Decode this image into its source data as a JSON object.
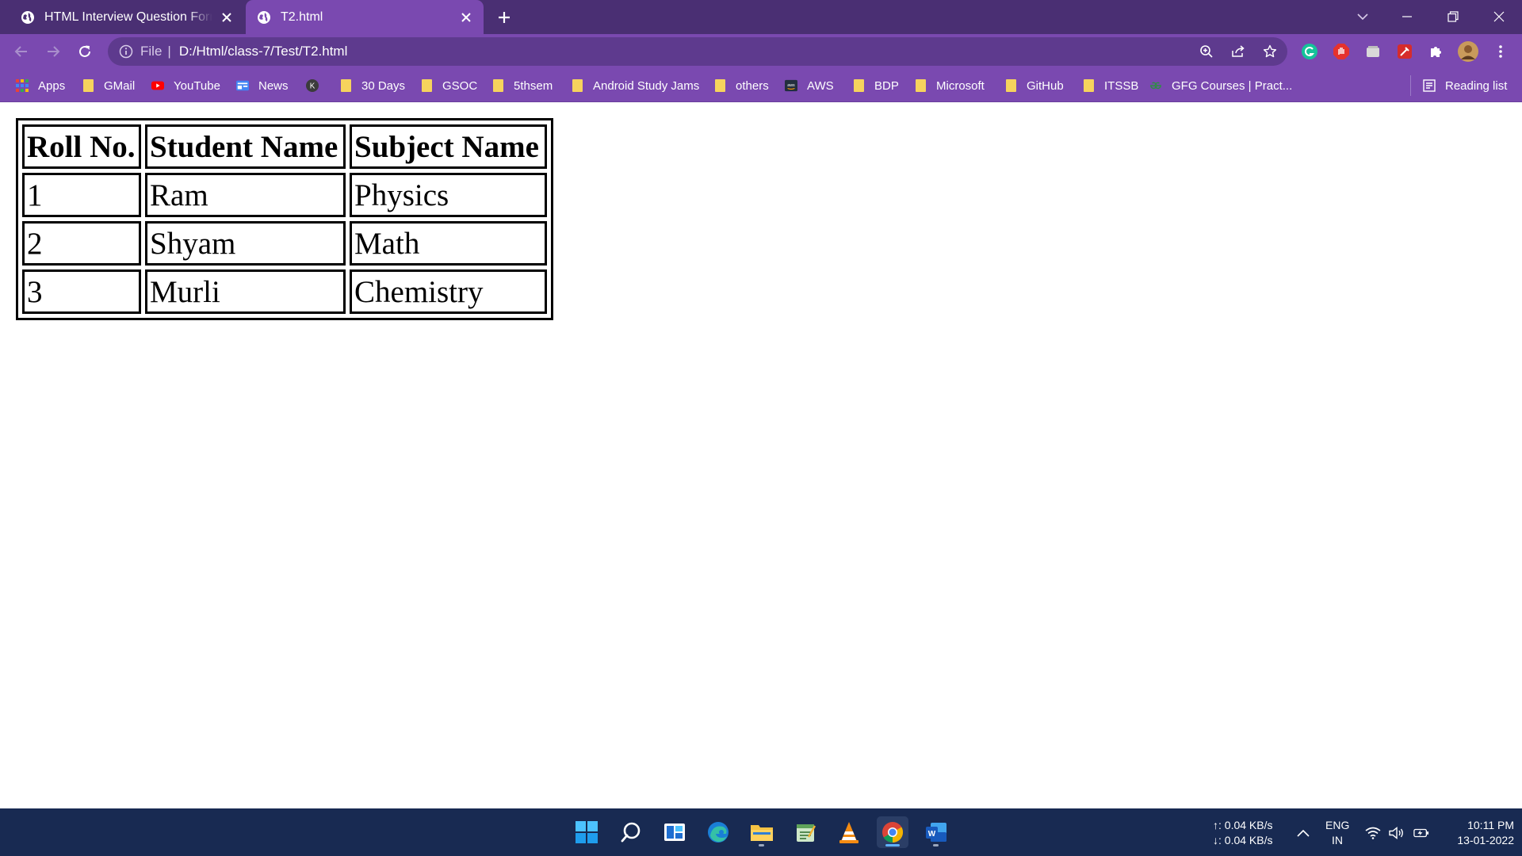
{
  "browser": {
    "tabs": [
      {
        "title": "HTML Interview Question Form t…",
        "icon": "globe-icon",
        "active": false
      },
      {
        "title": "T2.html",
        "icon": "globe-icon",
        "active": true
      }
    ],
    "address": {
      "scheme_label": "File",
      "url": "D:/Html/class-7/Test/T2.html"
    },
    "bookmarks": [
      {
        "label": "Apps",
        "icon": "apps-grid-icon"
      },
      {
        "label": "GMail",
        "icon": "folder-icon"
      },
      {
        "label": "YouTube",
        "icon": "youtube-icon"
      },
      {
        "label": "News",
        "icon": "google-news-icon"
      },
      {
        "label": "",
        "icon": "k-icon"
      },
      {
        "label": "30 Days",
        "icon": "folder-icon"
      },
      {
        "label": "GSOC",
        "icon": "folder-icon"
      },
      {
        "label": "5thsem",
        "icon": "folder-icon"
      },
      {
        "label": "Android Study Jams",
        "icon": "folder-icon"
      },
      {
        "label": "others",
        "icon": "folder-icon"
      },
      {
        "label": "AWS",
        "icon": "aws-icon"
      },
      {
        "label": "BDP",
        "icon": "folder-icon"
      },
      {
        "label": "Microsoft",
        "icon": "folder-icon"
      },
      {
        "label": "GitHub",
        "icon": "folder-icon"
      },
      {
        "label": "ITSSB",
        "icon": "folder-icon"
      },
      {
        "label": "GFG Courses | Pract...",
        "icon": "gfg-icon"
      }
    ],
    "reading_list": "Reading list",
    "colors": {
      "frame": "#4a2f73",
      "toolbar": "#7a49b0",
      "omnibox": "#5e3a8e"
    }
  },
  "page": {
    "table": {
      "headers": [
        "Roll No.",
        "Student Name",
        "Subject Name"
      ],
      "rows": [
        [
          "1",
          "Ram",
          "Physics"
        ],
        [
          "2",
          "Shyam",
          "Math"
        ],
        [
          "3",
          "Murli",
          "Chemistry"
        ]
      ]
    }
  },
  "taskbar": {
    "apps": [
      "windows-start-icon",
      "search-icon",
      "widgets-icon",
      "edge-icon",
      "file-explorer-icon",
      "notepad-icon",
      "vlc-icon",
      "chrome-icon",
      "word-icon"
    ],
    "network": {
      "upload": "↑: 0.04 KB/s",
      "download": "↓: 0.04 KB/s"
    },
    "language": {
      "line1": "ENG",
      "line2": "IN"
    },
    "clock": {
      "time": "10:11 PM",
      "date": "13-01-2022"
    },
    "colors": {
      "background": "#182a52"
    }
  }
}
